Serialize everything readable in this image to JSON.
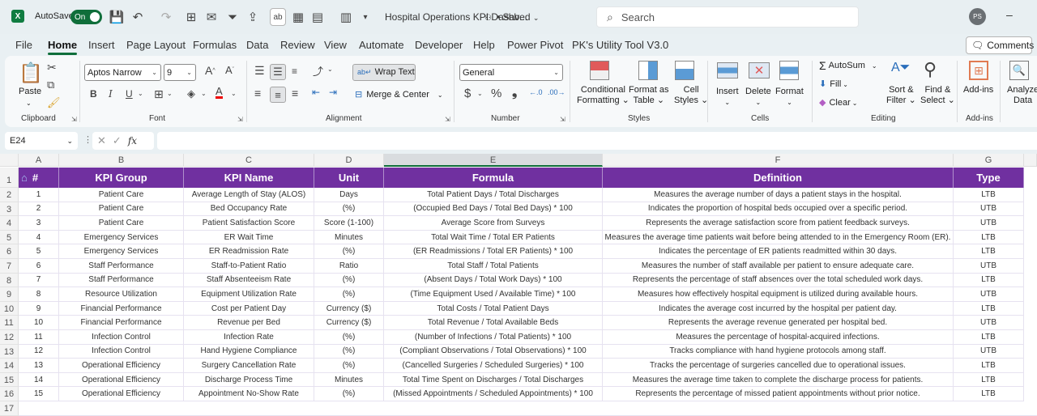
{
  "titlebar": {
    "app_icon": "excel-logo-icon",
    "autosave_label": "AutoSave",
    "autosave_state": "On",
    "document_title": "Hospital Operations KPI Dashb...",
    "save_status": "• Saved",
    "search_placeholder": "Search",
    "user_initials": "PS",
    "minimize_glyph": "–"
  },
  "tabs": [
    "File",
    "Home",
    "Insert",
    "Page Layout",
    "Formulas",
    "Data",
    "Review",
    "View",
    "Automate",
    "Developer",
    "Help",
    "Power Pivot",
    "PK's Utility Tool V3.0"
  ],
  "active_tab": "Home",
  "comments_label": "Comments",
  "ribbon": {
    "clipboard": {
      "label": "Clipboard",
      "paste": "Paste"
    },
    "font": {
      "label": "Font",
      "font_name": "Aptos Narrow",
      "font_size": "9",
      "bold": "B",
      "italic": "I",
      "underline": "U",
      "grow": "A",
      "shrink": "A"
    },
    "alignment": {
      "label": "Alignment",
      "wrap_text": "Wrap Text",
      "merge_center": "Merge & Center"
    },
    "number": {
      "label": "Number",
      "format": "General",
      "currency": "$",
      "percent": "%",
      "comma": "9"
    },
    "styles": {
      "label": "Styles",
      "conditional": [
        "Conditional",
        "Formatting"
      ],
      "format_table": [
        "Format as",
        "Table"
      ],
      "cell_styles": [
        "Cell",
        "Styles"
      ]
    },
    "cells": {
      "label": "Cells",
      "insert": "Insert",
      "delete": "Delete",
      "format": "Format"
    },
    "editing": {
      "label": "Editing",
      "autosum": "AutoSum",
      "fill": "Fill",
      "clear": "Clear",
      "sort": [
        "Sort &",
        "Filter"
      ],
      "find": [
        "Find &",
        "Select"
      ]
    },
    "addins": {
      "label": "Add-ins",
      "addins": "Add-ins"
    },
    "analyze": [
      "Analyze",
      "Data"
    ]
  },
  "formula_bar": {
    "name_box": "E24",
    "fx": "fx",
    "formula": ""
  },
  "sheet": {
    "columns": [
      "A",
      "B",
      "C",
      "D",
      "E",
      "F",
      "G"
    ],
    "selected_column": "E",
    "row_numbers": [
      "1",
      "2",
      "3",
      "4",
      "5",
      "6",
      "7",
      "8",
      "9",
      "10",
      "11",
      "12",
      "13",
      "14",
      "15",
      "16",
      "17"
    ],
    "header_color": "#7030a0",
    "headers": [
      "#",
      "KPI Group",
      "KPI Name",
      "Unit",
      "Formula",
      "Definition",
      "Type"
    ],
    "rows": [
      [
        "1",
        "Patient Care",
        "Average Length of Stay (ALOS)",
        "Days",
        "Total Patient Days / Total Discharges",
        "Measures the average number of days a patient stays in the hospital.",
        "LTB"
      ],
      [
        "2",
        "Patient Care",
        "Bed Occupancy Rate",
        "(%)",
        "(Occupied Bed Days / Total Bed Days) * 100",
        "Indicates the proportion of hospital beds occupied over a specific period.",
        "UTB"
      ],
      [
        "3",
        "Patient Care",
        "Patient Satisfaction Score",
        "Score (1-100)",
        "Average Score from Surveys",
        "Represents the average satisfaction score from patient feedback surveys.",
        "UTB"
      ],
      [
        "4",
        "Emergency Services",
        "ER Wait Time",
        "Minutes",
        "Total Wait Time / Total ER Patients",
        "Measures the average time patients wait before being attended to in the Emergency Room (ER).",
        "LTB"
      ],
      [
        "5",
        "Emergency Services",
        "ER Readmission Rate",
        "(%)",
        "(ER Readmissions / Total ER Patients) * 100",
        "Indicates the percentage of ER patients readmitted within 30 days.",
        "LTB"
      ],
      [
        "6",
        "Staff Performance",
        "Staff-to-Patient Ratio",
        "Ratio",
        "Total Staff / Total Patients",
        "Measures the number of staff available per patient to ensure adequate care.",
        "UTB"
      ],
      [
        "7",
        "Staff Performance",
        "Staff Absenteeism Rate",
        "(%)",
        "(Absent Days / Total Work Days) * 100",
        "Represents the percentage of staff absences over the total scheduled work days.",
        "LTB"
      ],
      [
        "8",
        "Resource Utilization",
        "Equipment Utilization Rate",
        "(%)",
        "(Time Equipment Used / Available Time) * 100",
        "Measures how effectively hospital equipment is utilized during available hours.",
        "UTB"
      ],
      [
        "9",
        "Financial Performance",
        "Cost per Patient Day",
        "Currency ($)",
        "Total Costs / Total Patient Days",
        "Indicates the average cost incurred by the hospital per patient day.",
        "LTB"
      ],
      [
        "10",
        "Financial Performance",
        "Revenue per Bed",
        "Currency ($)",
        "Total Revenue / Total Available Beds",
        "Represents the average revenue generated per hospital bed.",
        "UTB"
      ],
      [
        "11",
        "Infection Control",
        "Infection Rate",
        "(%)",
        "(Number of Infections / Total Patients) * 100",
        "Measures the percentage of hospital-acquired infections.",
        "LTB"
      ],
      [
        "12",
        "Infection Control",
        "Hand Hygiene Compliance",
        "(%)",
        "(Compliant Observations / Total Observations) * 100",
        "Tracks compliance with hand hygiene protocols among staff.",
        "UTB"
      ],
      [
        "13",
        "Operational Efficiency",
        "Surgery Cancellation Rate",
        "(%)",
        "(Cancelled Surgeries / Scheduled Surgeries) * 100",
        "Tracks the percentage of surgeries cancelled due to operational issues.",
        "LTB"
      ],
      [
        "14",
        "Operational Efficiency",
        "Discharge Process Time",
        "Minutes",
        "Total Time Spent on Discharges / Total Discharges",
        "Measures the average time taken to complete the discharge process for patients.",
        "LTB"
      ],
      [
        "15",
        "Operational Efficiency",
        "Appointment No-Show Rate",
        "(%)",
        "(Missed Appointments / Scheduled Appointments) * 100",
        "Represents the percentage of missed patient appointments without prior notice.",
        "LTB"
      ]
    ]
  }
}
